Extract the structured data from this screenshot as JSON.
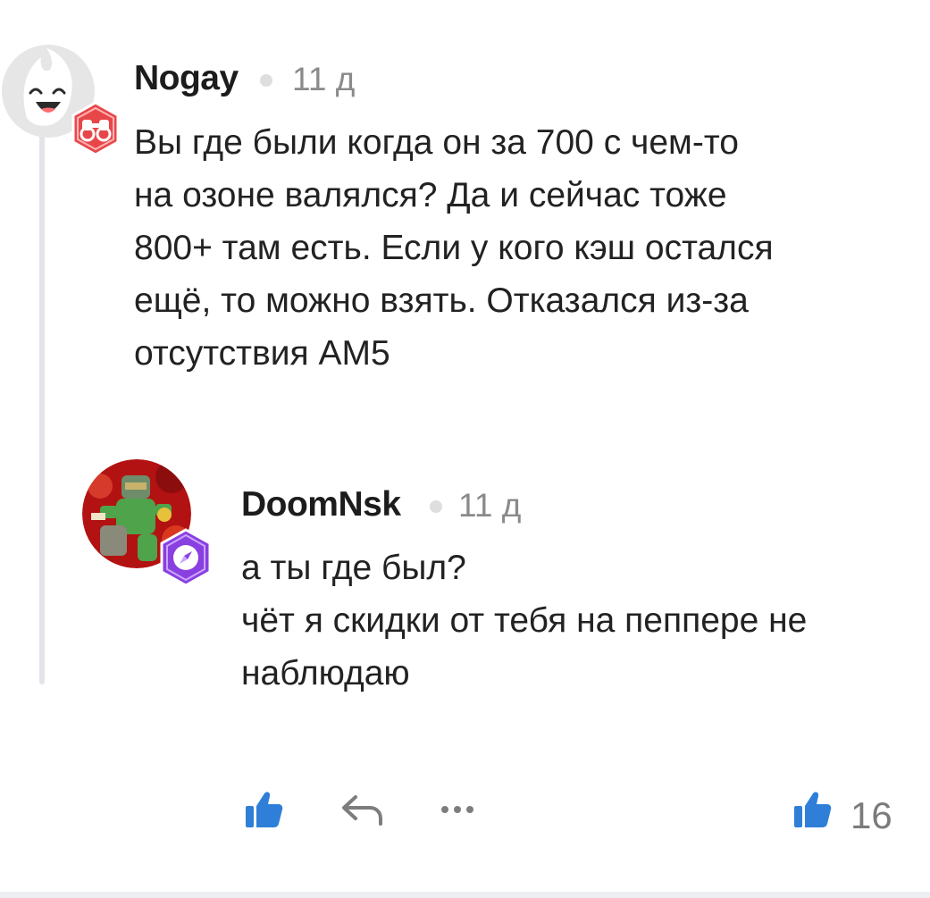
{
  "comment": {
    "author": "Nogay",
    "time": "11 д",
    "text": "Вы где были когда он за 700 с чем-то\nна озоне валялся? Да и сейчас тоже\n800+ там есть. Если у кого кэш остался\nещё, то можно взять. Отказался из-за\nотсутствия AM5",
    "avatar_icon": "ghost-avatar-icon",
    "badge_icon": "binoculars-badge-icon",
    "badge_color": "#e8474a"
  },
  "reply": {
    "author": "DoomNsk",
    "time": "11 д",
    "text": "а ты где был?\nчёт я скидки от тебя на пеппере не\nнаблюдаю",
    "avatar_icon": "doom-guy-avatar",
    "badge_icon": "compass-badge-icon",
    "badge_color": "#8a3fe0"
  },
  "actions": {
    "like_icon": "thumbs-up-icon",
    "reply_icon": "reply-arrow-icon",
    "more_icon": "more-dots-icon",
    "likes_icon": "thumbs-up-icon",
    "likes_count": "16",
    "accent": "#2f7fd8"
  }
}
